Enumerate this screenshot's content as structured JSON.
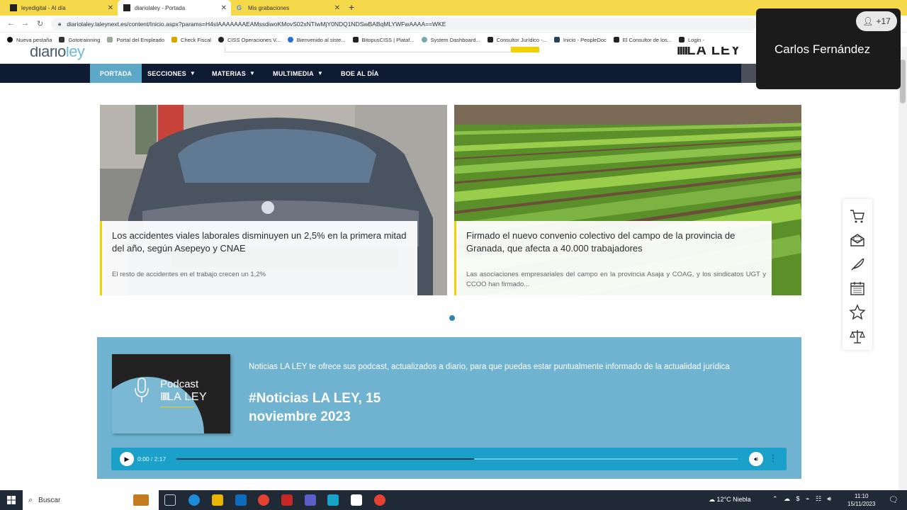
{
  "browser": {
    "tabs": [
      {
        "title": "leyedigital - Al día",
        "active": false
      },
      {
        "title": "diariolaley - Portada",
        "active": true
      },
      {
        "title": "Mis grabaciones",
        "active": false
      }
    ],
    "new_tab": "+",
    "url": "diariolaley.laleynext.es/content/Inicio.aspx?params=H4sIAAAAAAAEAMssdiwoKMovS02xNTIwMjY0NDQ1NDSwBABqMLYWFwAAAA==WKE",
    "bookmarks": [
      "Nueva pestaña",
      "Gototrainning",
      "Portal del Empleado",
      "Check Fiscal",
      "CISS Operaciones V...",
      "Bienvenido al siste...",
      "BitopusCISS | Plataf...",
      "System Dashboard...",
      "Consultor Jurídico -...",
      "Inicio - PeopleDoc",
      "El Consultor de los...",
      "Login -"
    ]
  },
  "site": {
    "logo_a": "diario",
    "logo_b": "ley",
    "brand_right": "LA LEY",
    "nav": [
      {
        "label": "PORTADA"
      },
      {
        "label": "SECCIONES"
      },
      {
        "label": "MATERIAS"
      },
      {
        "label": "MULTIMEDIA"
      },
      {
        "label": "BOE AL DÍA"
      }
    ]
  },
  "slides": [
    {
      "title": "Los accidentes viales laborales disminuyen un 2,5% en la primera mitad del año, según Asepeyo y CNAE",
      "summary": "El resto de accidentes en el trabajo crecen un 1,2%"
    },
    {
      "title": "Firmado el nuevo convenio colectivo del campo de la provincia de Granada, que afecta a 40.000 trabajadores",
      "summary": "Las asociaciones empresariales del campo en la provincia Asaja y COAG, y los sindicatos UGT y CCOO han firmado..."
    }
  ],
  "podcast": {
    "thumb_line1": "Podcast",
    "thumb_line2": "LA LEY",
    "description": "Noticias LA LEY te ofrece sus podcast, actualizados a diario, para que puedas estar puntualmente informado de la actualidad jurídica",
    "title": "#Noticias LA LEY, 15 noviembre 2023",
    "time_current": "0:00",
    "time_total": "2:17",
    "time_sep": "/",
    "progress": 0.53
  },
  "overlay": {
    "participant": "Carlos Fernández",
    "badge": "+17"
  },
  "taskbar": {
    "search": "Buscar",
    "weather": "12°C  Niebla",
    "time": "11:10",
    "date": "15/11/2023"
  },
  "colors": {
    "tabstrip": "#f6d94b",
    "nav_bg": "#0f1a33",
    "nav_active": "#5ea8c7",
    "podcast_bg": "#6fb3d0",
    "player": "#1ba0c9",
    "accent_yellow": "#f2d100"
  }
}
